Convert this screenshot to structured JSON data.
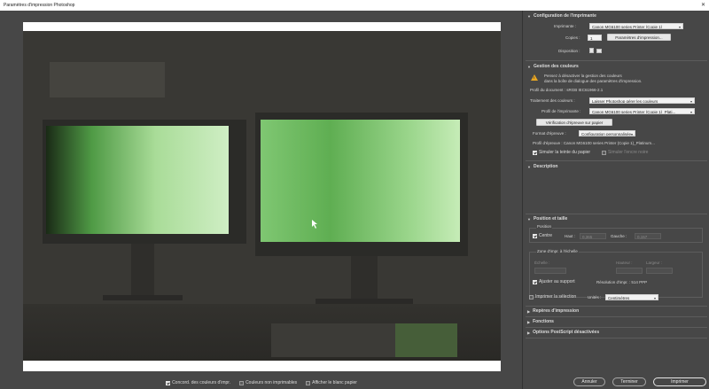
{
  "window": {
    "title": "Paramètres d'impression Photoshop",
    "close_glyph": "✕"
  },
  "preview": {
    "options": [
      {
        "label": "Concord. des couleurs d'impr.",
        "checked": true
      },
      {
        "label": "Couleurs non imprimables",
        "checked": false
      },
      {
        "label": "Afficher le blanc papier",
        "checked": false
      }
    ]
  },
  "printer_setup": {
    "title": "Configuration de l'imprimante",
    "printer_label": "Imprimante :",
    "printer_value": "Canon MG6100 series Printer (Copie 1)",
    "copies_label": "Copies :",
    "copies_value": "1",
    "settings_button": "Paramètres d'impression...",
    "layout_label": "Disposition :"
  },
  "color_management": {
    "title": "Gestion des couleurs",
    "warning_line1": "Pensez à désactiver la gestion des couleurs",
    "warning_line2": "dans la boîte de dialogue des paramètres d'impression.",
    "doc_profile": "Profil du document : sRGB IEC61966-2.1",
    "handling_label": "Traitement des couleurs :",
    "handling_value": "Laisser Photoshop gérer les couleurs",
    "printer_profile_label": "Profil de l'imprimante :",
    "printer_profile_value": "Canon MG6100 series Printer (Copie 1)_Plati...",
    "proof_button": "Vérification d'épreuve sur papier",
    "proof_format_label": "Format d'épreuve :",
    "proof_format_value": "Configuration personnalisée...",
    "proof_profile": "Profil d'épreuve : Canon MG6100 series Printer (Copie 1)_Platinum...",
    "simulate_paper": "Simuler la teinte du papier",
    "simulate_black": "Simuler l'encre noire"
  },
  "description": {
    "title": "Description"
  },
  "position_size": {
    "title": "Position et taille",
    "position_label": "Position",
    "center_label": "Centre",
    "top_label": "Haut :",
    "top_value": "0,365",
    "left_label": "Gauche :",
    "left_value": "0,157",
    "scaled_label": "Zone d'impr. à l'échelle",
    "scale_label": "Échelle :",
    "scale_value": "",
    "height_label": "Hauteur :",
    "width_label": "Largeur :",
    "fit_label": "Ajuster au support",
    "resolution_label": "Résolution d'impr. : 514 PPP",
    "print_selection_label": "Imprimer la sélection",
    "units_label": "Unités :",
    "units_value": "Centimètres"
  },
  "collapsed_sections": {
    "marks": "Repères d'impression",
    "functions": "Fonctions",
    "postscript": "Options PostScript désactivées"
  },
  "footer": {
    "cancel": "Annuler",
    "done": "Terminer",
    "print": "Imprimer"
  },
  "colors": {
    "panel": "#474747",
    "warning": "#e8a623",
    "screen_green": "#8fd88a"
  },
  "arrows": {
    "down": "▾",
    "collapsed": "▶",
    "expanded": "▼"
  }
}
